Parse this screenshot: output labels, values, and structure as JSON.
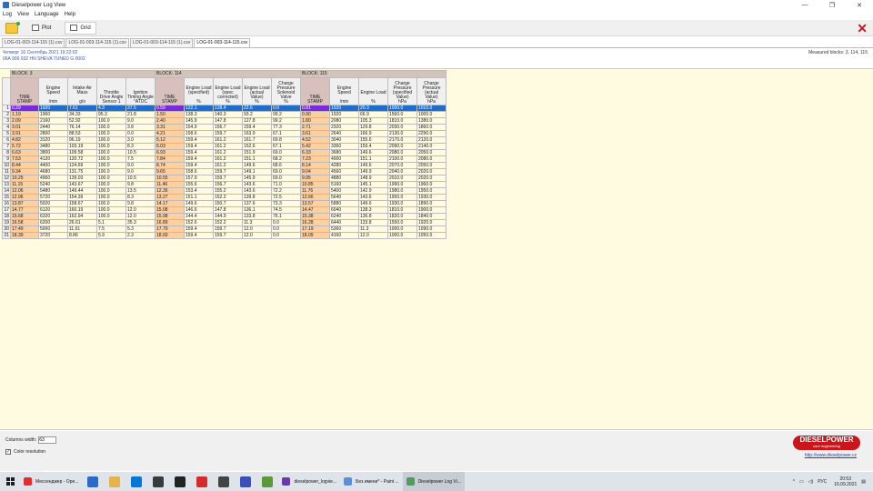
{
  "window": {
    "title": "Dieselpower Log View",
    "min": "—",
    "max": "❐",
    "close": "✕"
  },
  "menu": [
    "Log",
    "View",
    "Language",
    "Help"
  ],
  "toolbar": {
    "plot_label": "Plot",
    "grid_label": "Grid"
  },
  "file_tabs": [
    "LOG-01-003-114-115 (1).csv",
    "LOG-01-003-114-115 (1).csv",
    "LOG-01-003-114-115 (1).csv",
    "LOG-01-003-114-115.csv"
  ],
  "info": {
    "date": "Четверг 16 Сентябрь 2021 19:22:02",
    "vehicle": "06A 906 032 HN  SHEVA TUNED    G   0002",
    "measured": "Measured blocks: 3, 114, 115"
  },
  "blocks": [
    {
      "label": "BLOCK: 3",
      "cols": 5
    },
    {
      "label": "BLOCK: 114",
      "cols": 5
    },
    {
      "label": "BLOCK: 115",
      "cols": 5
    }
  ],
  "headers": [
    "TIME STAMP",
    "Engine Speed\n\n/min",
    "Intake Air Mass\n\ng/s",
    "Throttle Drive Angle Sensor 1",
    "Ignition Timing Angle °ATDC",
    "TIME STAMP",
    "Engine Load (specified)\n\n%",
    "Engine Load (spec corrected)\n%",
    "Engine Load (actual Value)\n%",
    "Charge Pressure Solenoid Valve\n%",
    "TIME STAMP",
    "Engine Speed\n\n/min",
    "Engine Load\n\n%",
    "Charge Pressure (specified Value)\nhPa",
    "Charge Pressure (actual Value)\nhPa"
  ],
  "rows": [
    [
      "0.29",
      "1920",
      "7.61",
      "4.3",
      "37.5",
      "0.59",
      "122.1",
      "128.4",
      "22.6",
      "0.0",
      "0.81",
      "1920",
      "20.3",
      "1000.0",
      "1010.0"
    ],
    [
      "1.19",
      "1960",
      "34.33",
      "95.3",
      "21.8",
      "1.50",
      "138.3",
      "140.3",
      "93.2",
      "99.2",
      "0.90",
      "1920",
      "66.9",
      "1560.0",
      "1000.0"
    ],
    [
      "2.09",
      "2160",
      "52.92",
      "100.0",
      "9.0",
      "2.40",
      "145.9",
      "147.8",
      "127.8",
      "99.2",
      "1.80",
      "2080",
      "105.3",
      "1810.0",
      "1380.0"
    ],
    [
      "3.01",
      "2440",
      "76.14",
      "100.0",
      "3.8",
      "3.31",
      "154.9",
      "156.7",
      "159.4",
      "77.3",
      "2.71",
      "2320",
      "129.8",
      "2030.0",
      "1860.0"
    ],
    [
      "3.91",
      "2800",
      "88.53",
      "100.0",
      "0.0",
      "4.21",
      "158.6",
      "159.7",
      "163.9",
      "67.1",
      "3.61",
      "2640",
      "166.9",
      "2130.0",
      "2290.0"
    ],
    [
      "4.82",
      "3120",
      "96.19",
      "100.0",
      "3.0",
      "5.12",
      "159.4",
      "161.2",
      "161.7",
      "69.8",
      "4.52",
      "3040",
      "155.6",
      "2170.0",
      "2120.0"
    ],
    [
      "5.72",
      "3480",
      "103.19",
      "100.0",
      "8.3",
      "6.03",
      "159.4",
      "161.2",
      "152.6",
      "67.1",
      "5.42",
      "3360",
      "159.4",
      "2090.0",
      "2140.0"
    ],
    [
      "6.63",
      "3800",
      "109.58",
      "100.0",
      "10.5",
      "6.93",
      "159.4",
      "161.2",
      "151.9",
      "69.0",
      "6.33",
      "3680",
      "149.6",
      "2080.0",
      "2050.0"
    ],
    [
      "7.53",
      "4120",
      "120.72",
      "100.0",
      "7.5",
      "7.84",
      "159.4",
      "161.2",
      "151.1",
      "68.2",
      "7.23",
      "4000",
      "151.1",
      "2100.0",
      "2080.0"
    ],
    [
      "8.44",
      "4400",
      "124.69",
      "100.0",
      "9.0",
      "8.74",
      "159.4",
      "161.2",
      "149.6",
      "68.6",
      "8.14",
      "4280",
      "149.6",
      "2070.0",
      "2050.0"
    ],
    [
      "9.34",
      "4680",
      "131.75",
      "100.0",
      "9.0",
      "9.65",
      "158.6",
      "159.7",
      "149.1",
      "69.0",
      "9.04",
      "4560",
      "149.9",
      "2040.0",
      "2020.0"
    ],
    [
      "10.25",
      "4960",
      "139.03",
      "100.0",
      "10.5",
      "10.55",
      "157.9",
      "159.7",
      "145.9",
      "69.0",
      "9.95",
      "4880",
      "148.9",
      "2010.0",
      "2020.0"
    ],
    [
      "11.15",
      "5240",
      "143.67",
      "100.0",
      "9.8",
      "11.46",
      "155.6",
      "156.7",
      "143.6",
      "71.0",
      "10.85",
      "5160",
      "145.1",
      "1990.0",
      "1960.0"
    ],
    [
      "12.06",
      "5480",
      "149.44",
      "100.0",
      "13.5",
      "12.36",
      "153.4",
      "155.2",
      "143.6",
      "72.2",
      "11.76",
      "5400",
      "142.9",
      "1980.0",
      "1950.0"
    ],
    [
      "12.96",
      "5720",
      "154.39",
      "100.0",
      "8.3",
      "13.27",
      "151.1",
      "152.2",
      "139.8",
      "72.5",
      "12.66",
      "5640",
      "143.6",
      "1950.0",
      "1930.0"
    ],
    [
      "13.87",
      "5920",
      "158.67",
      "100.0",
      "9.8",
      "14.17",
      "149.6",
      "150.7",
      "137.6",
      "73.3",
      "13.57",
      "5880",
      "149.6",
      "1930.0",
      "1890.0"
    ],
    [
      "14.77",
      "6120",
      "160.19",
      "100.0",
      "12.0",
      "15.08",
      "146.6",
      "147.8",
      "136.1",
      "74.5",
      "14.47",
      "6040",
      "138.3",
      "1810.0",
      "1900.0"
    ],
    [
      "15.68",
      "6320",
      "162.94",
      "100.0",
      "12.0",
      "15.98",
      "144.4",
      "144.9",
      "133.8",
      "76.1",
      "15.38",
      "6240",
      "136.8",
      "1820.0",
      "1840.0"
    ],
    [
      "16.58",
      "6200",
      "26.61",
      "5.1",
      "35.3",
      "16.89",
      "152.6",
      "152.2",
      "11.3",
      "0.0",
      "16.28",
      "6440",
      "133.8",
      "1550.0",
      "1920.0"
    ],
    [
      "17.49",
      "5000",
      "11.61",
      "7.5",
      "5.3",
      "17.79",
      "159.4",
      "159.7",
      "12.0",
      "0.0",
      "17.19",
      "5360",
      "11.3",
      "1000.0",
      "1090.0"
    ],
    [
      "18.39",
      "3720",
      "8.86",
      "5.9",
      "2.3",
      "18.69",
      "159.4",
      "159.7",
      "12.0",
      "0.0",
      "18.09",
      "4160",
      "12.0",
      "1000.0",
      "1050.0"
    ]
  ],
  "bottom": {
    "col_width_label": "Columns width:",
    "col_width_value": "63",
    "color_res_label": "Color resolution"
  },
  "logo": {
    "name": "DIESELPOWER",
    "sub": "race engineering",
    "url": "http://www.dieselpower.cz"
  },
  "taskbar": {
    "items": [
      {
        "label": "Мессенджер - Ope...",
        "color": "#e52b2b"
      },
      {
        "label": "dieselpower_logvie...",
        "color": "#6b3aa8"
      },
      {
        "label": "Без имени* - Paint ...",
        "color": "#5a8fd9"
      },
      {
        "label": "Dieselpower Log Vi...",
        "color": "#4b9e5e"
      }
    ],
    "lang": "РУС",
    "time": "20:53",
    "date": "16.09.2021"
  }
}
